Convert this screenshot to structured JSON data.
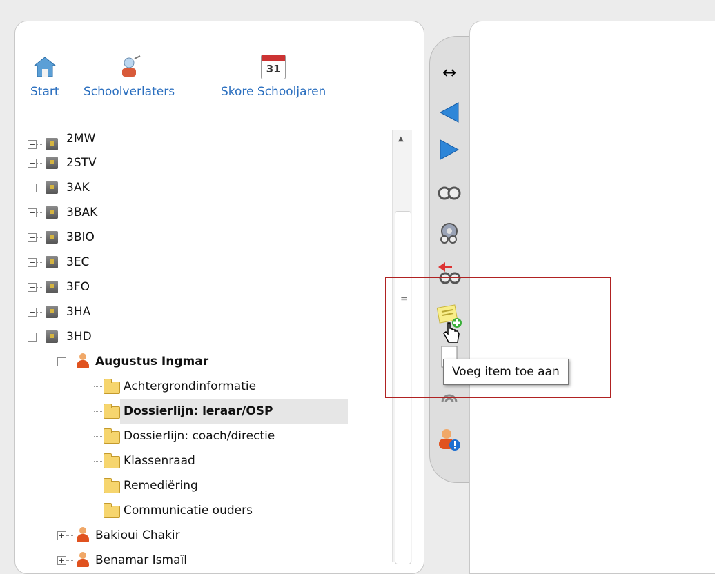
{
  "shortcuts": [
    {
      "label": "Start",
      "icon": "home-icon"
    },
    {
      "label": "Schoolverlaters",
      "icon": "graduate-icon"
    },
    {
      "label": "Skore Schooljaren",
      "icon": "calendar-icon",
      "calendar_day": "31"
    }
  ],
  "tree": {
    "classes": [
      "2MW",
      "2STV",
      "3AK",
      "3BAK",
      "3BIO",
      "3EC",
      "3FO",
      "3HA",
      "3HD"
    ],
    "expanded_student": "Augustus Ingmar",
    "folders": [
      "Achtergrondinformatie",
      "Dossierlijn: leraar/OSP",
      "Dossierlijn: coach/directie",
      "Klassenraad",
      "Remediëring",
      "Communicatie ouders"
    ],
    "selected_folder": "Dossierlijn: leraar/OSP",
    "other_students": [
      "Bakioui Chakir",
      "Benamar Ismaïl"
    ]
  },
  "toolbar": {
    "buttons": [
      "resize-icon",
      "back-arrow-icon",
      "forward-arrow-icon",
      "binoculars-icon",
      "gear-binoculars-icon",
      "arrow-binoculars-icon",
      "note-add-icon",
      "document-icon",
      "spiral-icon",
      "user-alert-icon"
    ]
  },
  "tooltip": {
    "text": "Voeg item toe aan"
  },
  "colors": {
    "link": "#2b6fbf",
    "highlight_border": "#b02222",
    "toolbar_bg": "#dedede",
    "selected_row": "#e6e6e6"
  }
}
